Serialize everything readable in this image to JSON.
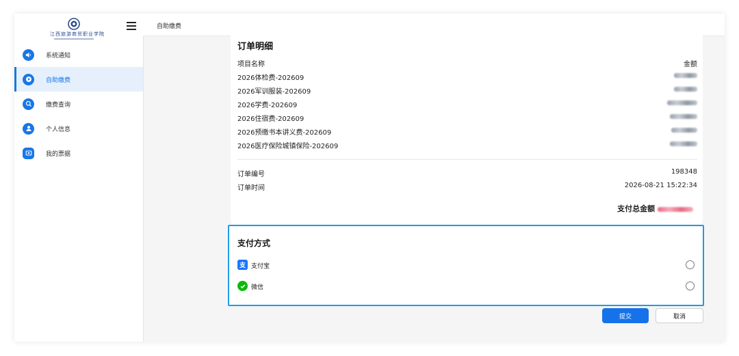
{
  "logo": {
    "text": "江西旅游商贸职业学院"
  },
  "sidebar": {
    "items": [
      {
        "label": "系统通知",
        "icon": "speaker-icon",
        "active": false
      },
      {
        "label": "自助缴费",
        "icon": "play-icon",
        "active": true
      },
      {
        "label": "缴费查询",
        "icon": "search-icon",
        "active": false
      },
      {
        "label": "个人信息",
        "icon": "user-icon",
        "active": false
      },
      {
        "label": "我的票据",
        "icon": "receipt-icon",
        "active": false
      }
    ]
  },
  "header": {
    "breadcrumb": "自助缴费"
  },
  "order": {
    "title": "订单明细",
    "col_name": "项目名称",
    "col_amount": "金额",
    "items": [
      {
        "name": "2026体检费-202609"
      },
      {
        "name": "2026军训服装-202609"
      },
      {
        "name": "2026学费-202609"
      },
      {
        "name": "2026住宿费-202609"
      },
      {
        "name": "2026预缴书本讲义费-202609"
      },
      {
        "name": "2026医疗保险城镇保险-202609"
      }
    ],
    "order_no_label": "订单编号",
    "order_no": "198348",
    "order_time_label": "订单时间",
    "order_time": "2026-08-21 15:22:34",
    "total_label": "支付总金额"
  },
  "payment": {
    "title": "支付方式",
    "options": [
      {
        "label": "支付宝",
        "icon": "alipay-icon",
        "color": "#1677ff"
      },
      {
        "label": "微信",
        "icon": "wechat-pay-icon",
        "color": "#09bb07"
      }
    ]
  },
  "actions": {
    "submit": "提交",
    "cancel": "取消"
  },
  "colors": {
    "accent": "#1976e8",
    "highlight_border": "#1e9be6"
  }
}
